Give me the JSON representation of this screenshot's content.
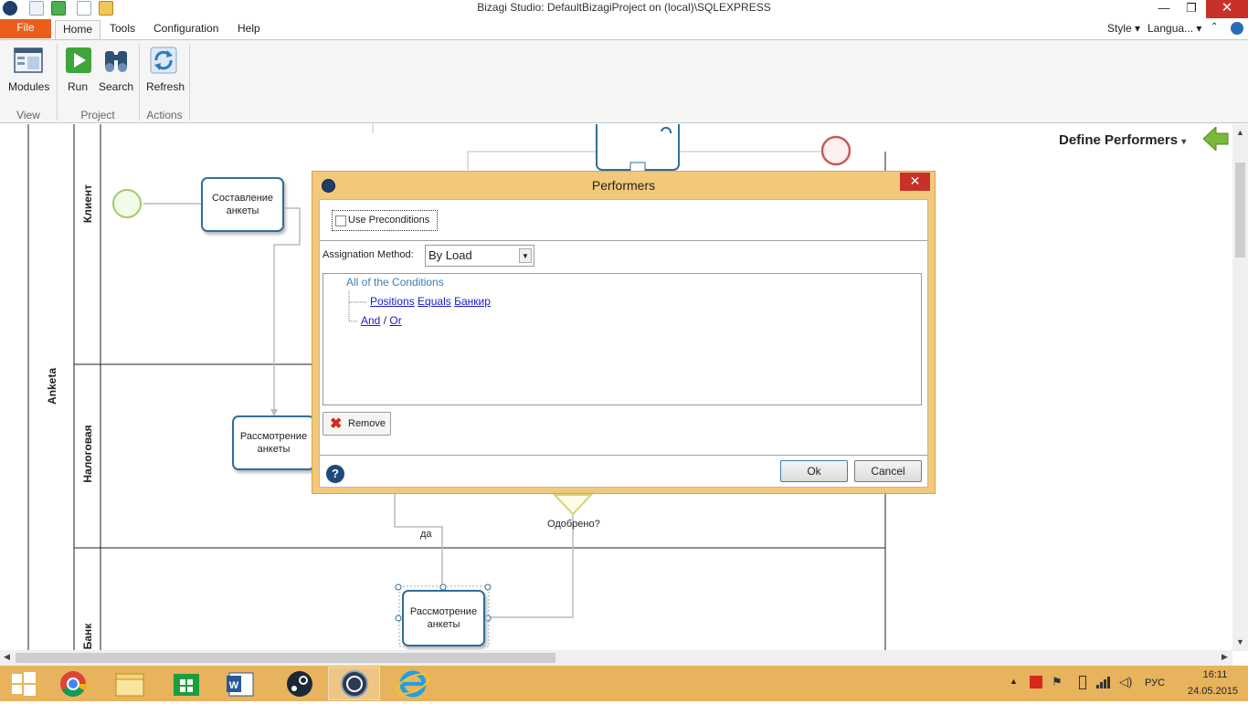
{
  "window": {
    "title": "Bizagi Studio: DefaultBizagiProject on (local)\\SQLEXPRESS",
    "minimize": "—",
    "restore": "❐",
    "close": "✕"
  },
  "ribbon": {
    "tabs": [
      "File",
      "Home",
      "Tools",
      "Configuration",
      "Help"
    ],
    "right_menus": [
      "Style ▾",
      "Langua... ▾"
    ],
    "buttons": {
      "modules": "Modules",
      "run": "Run",
      "search": "Search",
      "refresh": "Refresh"
    },
    "groups": [
      "View",
      "Project",
      "Actions"
    ]
  },
  "diagram": {
    "pool_name": "Anketa",
    "lanes": [
      "Клиент",
      "Налоговая",
      "Банк"
    ],
    "tasks": {
      "compose": "Составление анкеты",
      "review_tax": "Рассмотрение анкеты",
      "review_bank": "Рассмотрение анкеты"
    },
    "gateway_label": "Одобрено?",
    "flow_label_yes": "да",
    "define_performers": "Define Performers",
    "define_performers_arrow": "▾"
  },
  "dialog": {
    "title": "Performers",
    "close": "✕",
    "use_preconditions": "Use Preconditions",
    "assignation_label": "Assignation Method:",
    "assignation_value": "By Load",
    "conditions": {
      "header": "All of the Conditions",
      "field": "Positions",
      "operator": "Equals",
      "value": "Банкир",
      "and": "And",
      "sep": "/",
      "or": "Or"
    },
    "remove": "Remove",
    "help": "?",
    "ok": "Ok",
    "cancel": "Cancel"
  },
  "taskbar": {
    "language": "РУС",
    "time": "16:11",
    "date": "24.05.2015"
  }
}
